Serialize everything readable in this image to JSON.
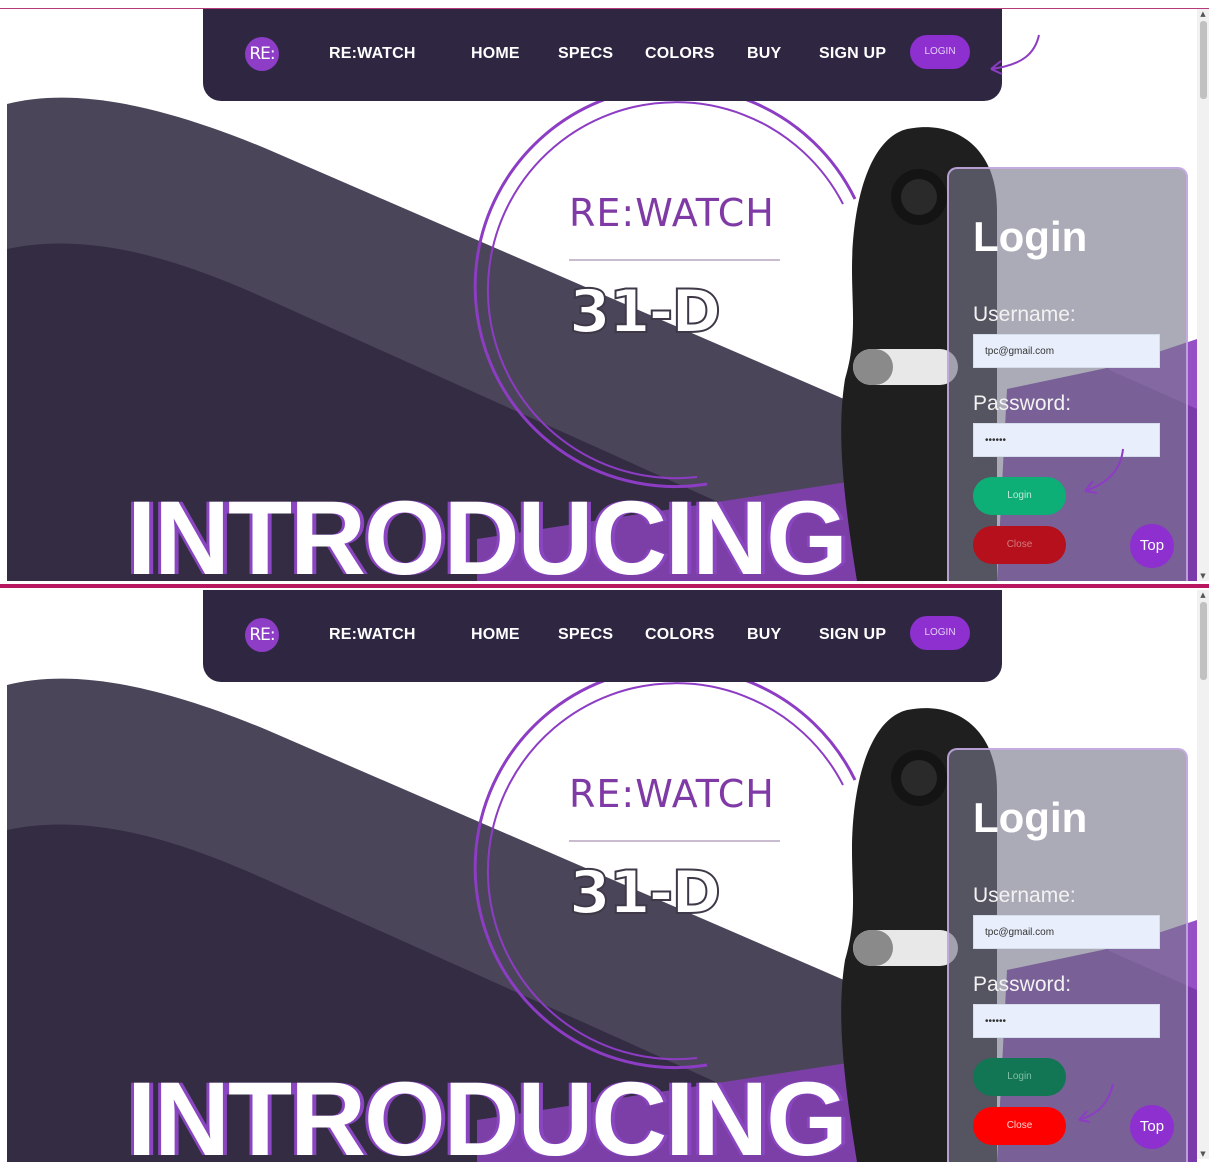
{
  "nav": {
    "logo_text": "RE:",
    "brand": "RE:WATCH",
    "items": [
      "HOME",
      "SPECS",
      "COLORS",
      "BUY",
      "SIGN UP"
    ],
    "login_label": "LOGIN"
  },
  "hero": {
    "brand_text": "RE:WATCH",
    "model_text": "31-D",
    "headline": "INTRODUCING"
  },
  "login_form": {
    "title": "Login",
    "username_label": "Username:",
    "username_value": "tpc@gmail.com",
    "password_label": "Password:",
    "password_value": "••••••",
    "login_button": "Login",
    "close_button": "Close"
  },
  "top_button": "Top",
  "colors": {
    "nav_bg": "#2f2742",
    "accent_purple": "#8e2fd0",
    "login_green": "#0daf76",
    "close_red_frame1": "#b5101c",
    "login_green_frame2": "#127553",
    "close_red_frame2": "#ff0000"
  },
  "frames": [
    {
      "state": "login-hover",
      "login_color": "#0daf76",
      "login_text_color": "#bfe9d6",
      "close_color": "#b5101c",
      "close_text_color": "#d47b80"
    },
    {
      "state": "close-hover",
      "login_color": "#127553",
      "login_text_color": "#7ec0a5",
      "close_color": "#ff0000",
      "close_text_color": "#ffd0d0"
    }
  ]
}
